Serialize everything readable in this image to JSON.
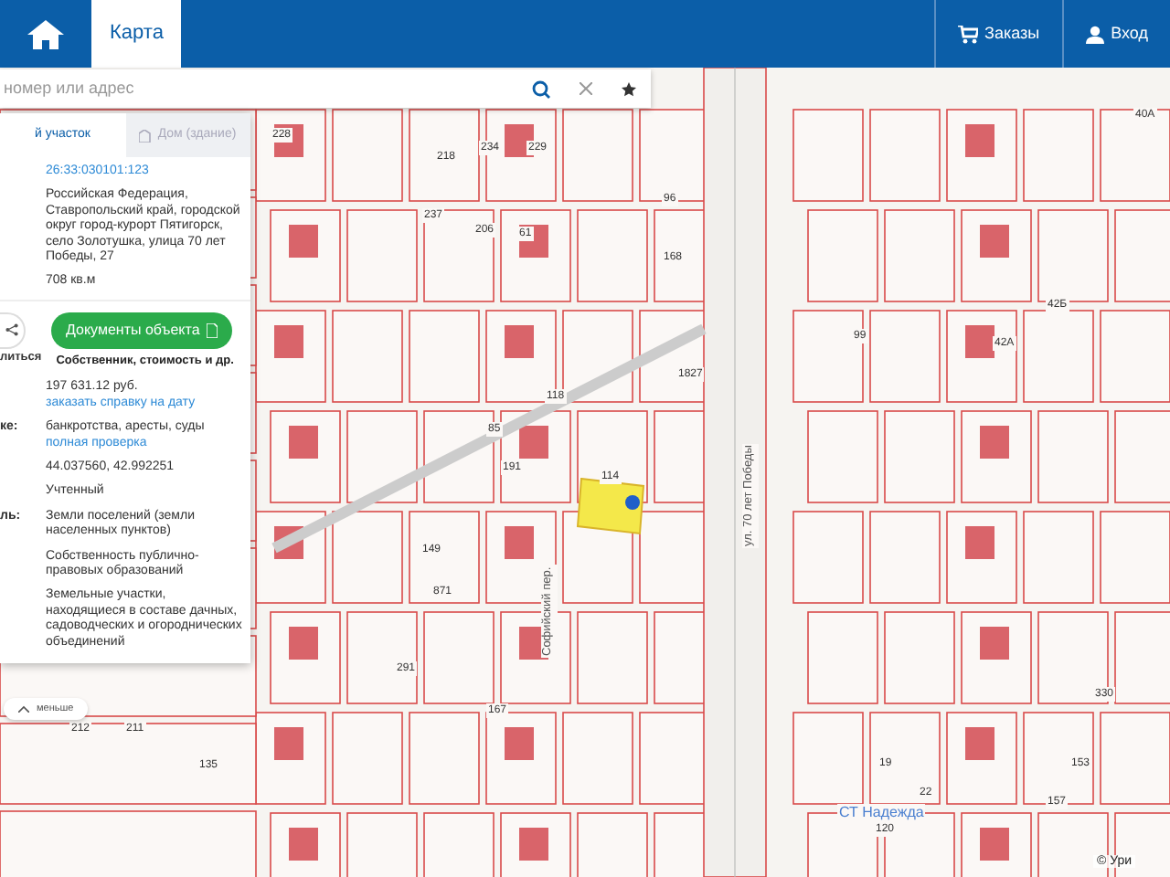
{
  "header": {
    "tabs": [
      {
        "label": "Карта",
        "selected": true
      }
    ],
    "actions": [
      {
        "label": "Заказы",
        "kind": "cart"
      },
      {
        "label": "Вход",
        "kind": "user"
      }
    ]
  },
  "search": {
    "placeholder": "номер или адрес"
  },
  "panel": {
    "tabs": [
      {
        "label": "й участок",
        "selected": true
      },
      {
        "label": "Дом (здание)",
        "selected": false
      }
    ],
    "cadastral_number": "26:33:030101:123",
    "address": "Российская Федерация, Ставропольский край, городской округ город-курорт Пятигорск, село Золотушка, улица 70 лет Победы, 27",
    "area": "708 кв.м",
    "share_label": "литься",
    "documents_button": "Документы объекта",
    "documents_caption": "Собственник, стоимость и др.",
    "rows": [
      {
        "label": "",
        "text": "197 631.12 руб.",
        "link": "заказать справку на дату"
      },
      {
        "label": "ке:",
        "text": "банкротства, аресты, суды",
        "link": "полная проверка"
      },
      {
        "label": "",
        "text": "44.037560, 42.992251",
        "link": ""
      },
      {
        "label": "",
        "text": "Учтенный",
        "link": ""
      },
      {
        "label": "ль:",
        "text": "Земли поселений (земли населенных пунктов)",
        "link": ""
      },
      {
        "label": "",
        "text": "Собственность публично-правовых образований",
        "link": ""
      },
      {
        "label": "",
        "text": "Земельные участки, находящиеся в составе дачных, садоводческих и огороднических объединений",
        "link": ""
      }
    ],
    "less_button": "меньше"
  },
  "map_labels": [
    {
      "text": "228",
      "kind": "parcel"
    },
    {
      "text": "234",
      "kind": "parcel"
    },
    {
      "text": "229",
      "kind": "parcel"
    },
    {
      "text": "218",
      "kind": "parcel"
    },
    {
      "text": "96",
      "kind": "parcel"
    },
    {
      "text": "237",
      "kind": "parcel"
    },
    {
      "text": "206",
      "kind": "parcel"
    },
    {
      "text": "61",
      "kind": "parcel"
    },
    {
      "text": "168",
      "kind": "parcel"
    },
    {
      "text": "99",
      "kind": "parcel"
    },
    {
      "text": "1827",
      "kind": "parcel"
    },
    {
      "text": "118",
      "kind": "parcel"
    },
    {
      "text": "85",
      "kind": "parcel"
    },
    {
      "text": "114",
      "kind": "parcel"
    },
    {
      "text": "191",
      "kind": "parcel"
    },
    {
      "text": "149",
      "kind": "parcel"
    },
    {
      "text": "871",
      "kind": "parcel"
    },
    {
      "text": "291",
      "kind": "parcel"
    },
    {
      "text": "167",
      "kind": "parcel"
    },
    {
      "text": "135",
      "kind": "parcel"
    },
    {
      "text": "212",
      "kind": "parcel"
    },
    {
      "text": "211",
      "kind": "parcel"
    },
    {
      "text": "19",
      "kind": "parcel"
    },
    {
      "text": "22",
      "kind": "parcel"
    },
    {
      "text": "120",
      "kind": "parcel"
    },
    {
      "text": "153",
      "kind": "parcel"
    },
    {
      "text": "157",
      "kind": "parcel"
    },
    {
      "text": "330",
      "kind": "parcel"
    },
    {
      "text": "42Б",
      "kind": "parcel"
    },
    {
      "text": "42А",
      "kind": "parcel"
    },
    {
      "text": "40А",
      "kind": "parcel"
    },
    {
      "text": "ул. 70 лет Победы",
      "kind": "street"
    },
    {
      "text": "Софийский пер.",
      "kind": "street"
    },
    {
      "text": "СТ Надежда",
      "kind": "place"
    },
    {
      "text": "© Ури",
      "kind": "copyright"
    }
  ]
}
